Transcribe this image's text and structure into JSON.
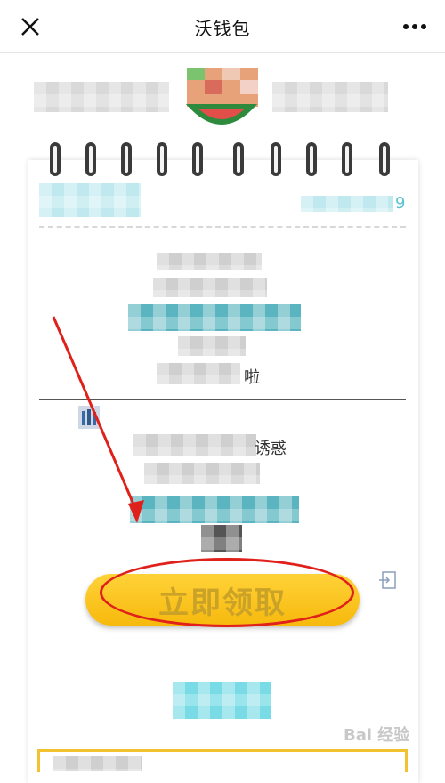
{
  "header": {
    "title": "沃钱包"
  },
  "card": {
    "partial_text_1": "啦",
    "partial_text_2": "诱惑",
    "partial_text_3": "9",
    "claim_button_label": "立即领取"
  },
  "watermark": {
    "text": "Bai 经验"
  },
  "colors": {
    "button_yellow": "#f7b90d",
    "annotation_red": "#e0201b",
    "mosaic_teal": "#5bb5c0"
  }
}
